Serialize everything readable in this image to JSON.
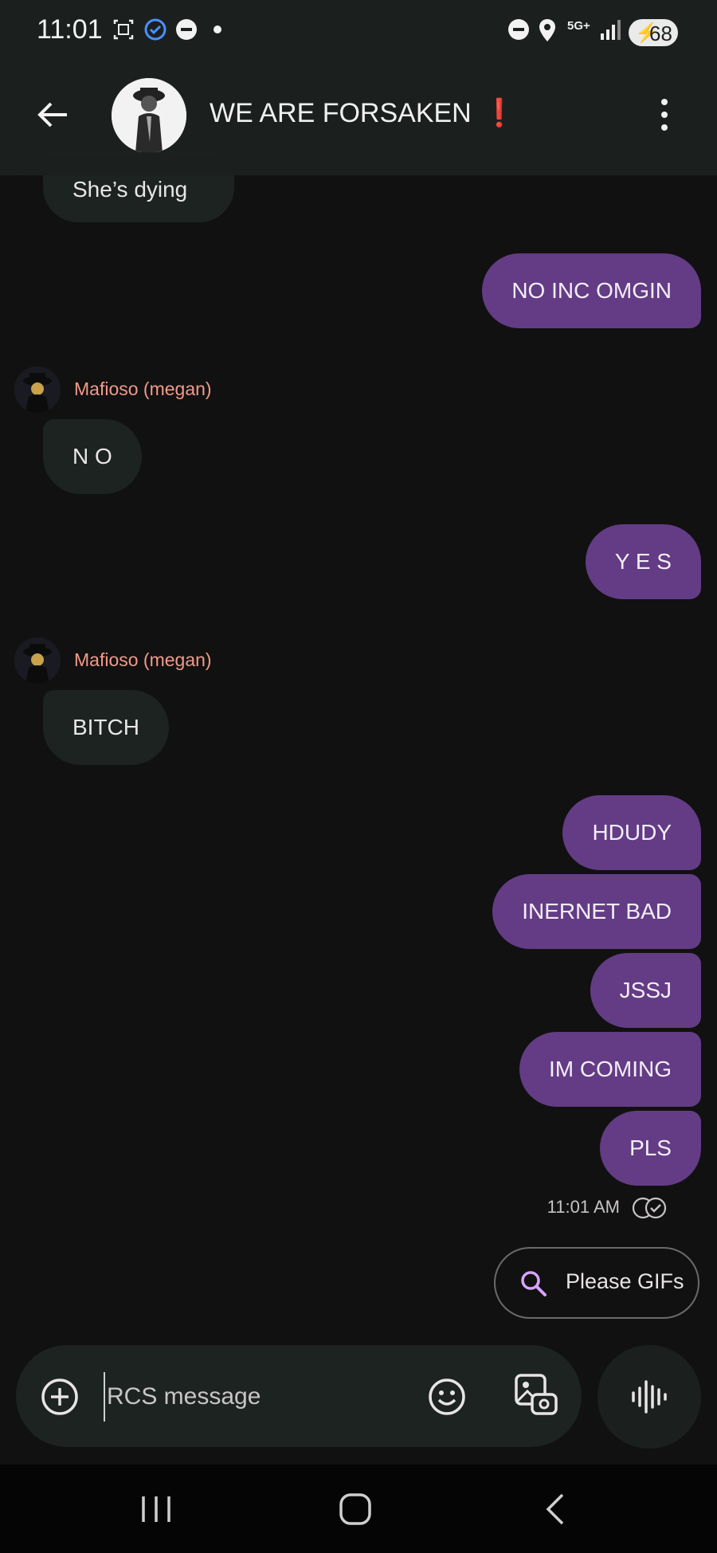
{
  "status_bar": {
    "time": "11:01",
    "network": "5G+",
    "battery": "68",
    "icons": [
      "screenshot-icon",
      "verified-check-icon",
      "do-not-disturb-icon",
      "dot-icon",
      "dnd-icon",
      "location-icon",
      "network-5g-icon",
      "signal-icon",
      "battery-icon"
    ]
  },
  "header": {
    "title": "WE ARE FORSAKEN",
    "title_mark": "❗",
    "back_icon": "back-arrow-icon",
    "menu_icon": "more-vert-icon"
  },
  "messages": [
    {
      "type": "in",
      "text": "She’s dying"
    },
    {
      "type": "out",
      "text": "NO INC OMGIN"
    },
    {
      "type": "in",
      "sender": "Mafioso (megan)",
      "text": "N O"
    },
    {
      "type": "out",
      "text": "Y E S"
    },
    {
      "type": "in",
      "sender": "Mafioso (megan)",
      "text": "BITCH"
    },
    {
      "type": "out",
      "text": "HDUDY"
    },
    {
      "type": "out",
      "text": "INERNET BAD"
    },
    {
      "type": "out",
      "text": "JSSJ"
    },
    {
      "type": "out",
      "text": "IM COMING"
    },
    {
      "type": "out",
      "text": "PLS"
    }
  ],
  "timestamp": "11:01 AM",
  "gif_suggestion": "Please GIFs",
  "composer": {
    "placeholder": "RCS message"
  },
  "colors": {
    "outgoing_bubble": "#633c85",
    "incoming_bubble": "#1d2321",
    "sender_name": "#f29a8a",
    "background": "#111111"
  }
}
